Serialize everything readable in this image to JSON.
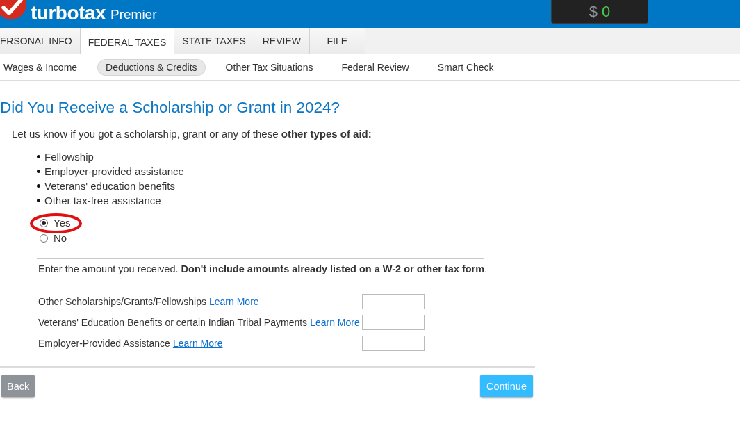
{
  "header": {
    "brand": "turbotax",
    "edition": "Premier",
    "refund": {
      "currency": "$",
      "amount": "0"
    }
  },
  "tabs": [
    {
      "label": "ERSONAL INFO",
      "selected": false
    },
    {
      "label": "FEDERAL TAXES",
      "selected": true
    },
    {
      "label": "STATE TAXES",
      "selected": false
    },
    {
      "label": "REVIEW",
      "selected": false
    },
    {
      "label": "FILE",
      "selected": false
    }
  ],
  "subnav": [
    {
      "label": "Wages & Income",
      "selected": false
    },
    {
      "label": "Deductions & Credits",
      "selected": true
    },
    {
      "label": "Other Tax Situations",
      "selected": false
    },
    {
      "label": "Federal Review",
      "selected": false
    },
    {
      "label": "Smart Check",
      "selected": false
    }
  ],
  "page": {
    "title": "Did You Receive a Scholarship or Grant in 2024?",
    "intro": "Let us know if you got a scholarship, grant or any of these **other types of aid:**",
    "aid_types": [
      "Fellowship",
      "Employer-provided assistance",
      "Veterans' education benefits",
      "Other tax-free assistance"
    ],
    "options": [
      {
        "label": "Yes",
        "selected": true,
        "circled": true
      },
      {
        "label": "No",
        "selected": false,
        "circled": false
      }
    ],
    "amount_prompt": "Enter the amount you received. **Don't include amounts already listed on a W-2 or other tax form**.",
    "amount_fields": [
      {
        "label": "Other Scholarships/Grants/Fellowships",
        "link": "Learn More"
      },
      {
        "label": "Veterans' Education Benefits or certain Indian Tribal Payments",
        "link": "Learn More"
      },
      {
        "label": "Employer-Provided Assistance",
        "link": "Learn More"
      }
    ]
  },
  "buttons": {
    "back": "Back",
    "continue": "Continue"
  }
}
